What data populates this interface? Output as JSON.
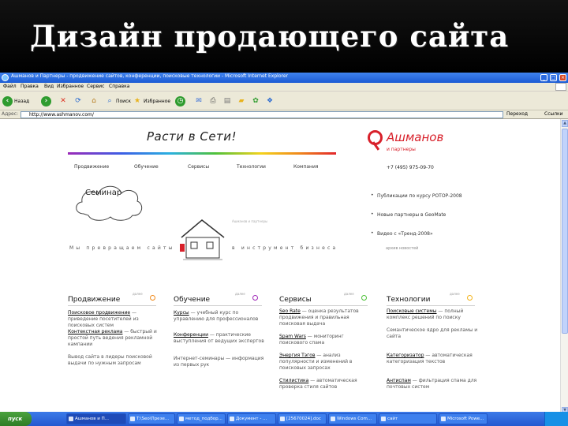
{
  "slide": {
    "title": "Дизайн продающего сайта"
  },
  "browser": {
    "title": "Ашманов и Партнеры - продвижение сайтов, конференции, поисковые технологии - Microsoft Internet Explorer",
    "menu": [
      "Файл",
      "Правка",
      "Вид",
      "Избранное",
      "Сервис",
      "Справка"
    ],
    "toolbar": {
      "back": "Назад",
      "search": "Поиск",
      "favorites": "Избранное"
    },
    "address_label": "Адрес:",
    "address": "http://www.ashmanov.com/",
    "go_label": "Переход",
    "links_label": "Ссылки"
  },
  "site": {
    "logo": "Расти в Сети!",
    "nav": [
      "Продвижение",
      "Обучение",
      "Сервисы",
      "Технологии",
      "Компания"
    ],
    "brand_name": "Ашманов",
    "brand_sub": "и партнеры",
    "phone": "+7 (495) 975-09-70",
    "cloud_label": "Семинар",
    "house_caption": "Ашманов и партнеры",
    "tagline_left": "Мы превращаем сайты",
    "tagline_right": "в инструмент бизнеса",
    "news": [
      "Публикации по курсу РОТОР-2008",
      "Новые партнеры в GeoMate",
      "Видео с «Тренд-2008»"
    ],
    "news_all": "архив новостей",
    "columns": [
      {
        "title": "Продвижение",
        "more": "далее",
        "items": [
          {
            "link": "Поисковое продвижение",
            "text": " — приведение посетителей из поисковых систем"
          },
          {
            "link": "Контекстная реклама",
            "text": " — быстрый и простой путь ведения рекламной кампании"
          },
          {
            "link": "",
            "text": "Вывод сайта в лидеры поисковой выдачи по нужным запросам"
          }
        ]
      },
      {
        "title": "Обучение",
        "more": "далее",
        "items": [
          {
            "link": "Курсы",
            "text": " — учебный курс по управлению для профессионалов"
          },
          {
            "link": "Конференции",
            "text": " — практические выступления от ведущих экспертов"
          },
          {
            "link": "",
            "text": "Интернет-семинары — информация из первых рук"
          }
        ]
      },
      {
        "title": "Сервисы",
        "more": "далее",
        "items": [
          {
            "link": "Seo Rate",
            "text": " — оценка результатов продвижения и правильная поисковая выдача"
          },
          {
            "link": "Spam Wars",
            "text": " — мониторинг поискового спама"
          },
          {
            "link": "Энергия Тэгов",
            "text": " — анализ популярности и изменений в поисковых запросах"
          },
          {
            "link": "Стилистика",
            "text": " — автоматическая проверка стиля сайтов"
          }
        ]
      },
      {
        "title": "Технологии",
        "more": "далее",
        "items": [
          {
            "link": "Поисковые системы",
            "text": " — полный комплекс решений по поиску"
          },
          {
            "link": "",
            "text": "Семантическое ядро для рекламы и сайта"
          },
          {
            "link": "Категоризатор",
            "text": " — автоматическая категоризация текстов"
          },
          {
            "link": "Антиспам",
            "text": " — фильтрация спама для почтовых систем"
          }
        ]
      }
    ]
  },
  "taskbar": {
    "start": "пуск",
    "tasks": [
      "Ашманов и П...",
      "T:\\Seo\\Презе...",
      "метод_подбор...",
      "Документ - ...",
      "[25670024].doc",
      "Windows Com...",
      "сайт",
      "Microsoft Powe..."
    ]
  },
  "colors": {
    "accent": "#d8202a",
    "xp_blue": "#2458d0",
    "rainbow": [
      "#9b2ab8",
      "#3c5ee5",
      "#2ab0e0",
      "#4fc13a",
      "#f4d21c",
      "#f08a1c",
      "#e2262b"
    ],
    "power_icons": [
      "#f08a1c",
      "#a02ab8",
      "#4fc13a",
      "#f4b41c"
    ]
  }
}
